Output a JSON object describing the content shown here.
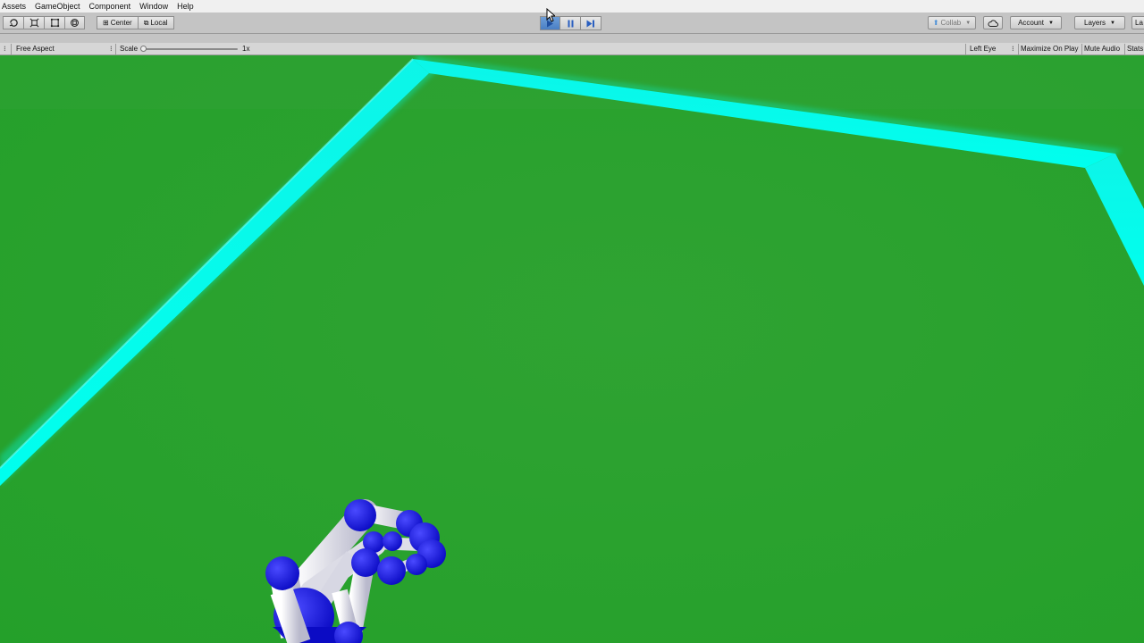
{
  "menu": [
    "Assets",
    "GameObject",
    "Component",
    "Window",
    "Help"
  ],
  "toolbar": {
    "tools": [
      "rotate-icon",
      "scale-icon",
      "rect-icon",
      "transform-icon"
    ],
    "pivot_center": "Center",
    "pivot_local": "Local",
    "play_active": true,
    "collab_label": "Collab",
    "account_label": "Account",
    "layers_label": "Layers",
    "layout_label": "La"
  },
  "game_view": {
    "aspect": "Free Aspect",
    "scale_label": "Scale",
    "scale_value": "1x",
    "eye": "Left Eye",
    "maximize": "Maximize On Play",
    "mute": "Mute Audio",
    "stats": "Stats"
  },
  "colors": {
    "ground": "#2ca02c",
    "border": "#00ffee",
    "hand_joints": "#1a1ae0",
    "hand_bones": "#e6e6f0",
    "play_active": "#4a7fc4"
  }
}
